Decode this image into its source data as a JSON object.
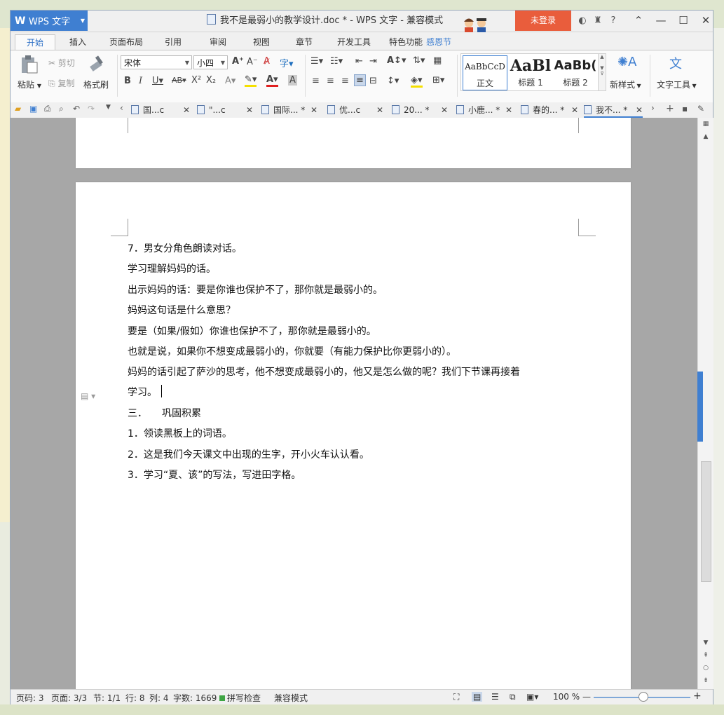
{
  "window": {
    "app_button": "WPS 文字",
    "title": "我不是最弱小的教学设计.doc * - WPS 文字 - 兼容模式",
    "login": "未登录"
  },
  "menu": {
    "tabs": [
      "开始",
      "插入",
      "页面布局",
      "引用",
      "审阅",
      "视图",
      "章节",
      "开发工具",
      "特色功能",
      "感恩节"
    ]
  },
  "ribbon": {
    "paste": "粘贴",
    "cut": "剪切",
    "copy": "复制",
    "format_painter": "格式刷",
    "font_name": "宋体",
    "font_size": "小四",
    "styles": [
      {
        "preview": "AaBbCcD",
        "label": "正文"
      },
      {
        "preview": "AaBl",
        "label": "标题 1"
      },
      {
        "preview": "AaBb(",
        "label": "标题 2"
      }
    ],
    "new_style": "新样式",
    "text_tools": "文字工具"
  },
  "doc_tabs": [
    "国...c",
    "\"...c",
    "国际... *",
    "优...c",
    "20... *",
    "小鹿... *",
    "春的... *",
    "我不... *"
  ],
  "document": {
    "lines": [
      "7．男女分角色朗读对话。",
      "学习理解妈妈的话。",
      "出示妈妈的话：要是你谁也保护不了，那你就是最弱小的。",
      "妈妈这句话是什么意思？",
      "要是（如果/假如）你谁也保护不了，那你就是最弱小的。",
      "也就是说，如果你不想变成最弱小的，你就要（有能力保护比你更弱小的）。",
      "妈妈的话引起了萨沙的思考，他不想变成最弱小的，他又是怎么做的呢？我们下节课再接着",
      "学习。",
      "三．　　巩固积累",
      "1．领读黑板上的词语。",
      "2．这是我们今天课文中出现的生字，开小火车认认看。",
      "3．学习“夏、该”的写法，写进田字格。"
    ]
  },
  "status": {
    "page_code": "页码: 3",
    "pages": "页面: 3/3",
    "section": "节: 1/1",
    "row": "行: 8",
    "col": "列: 4",
    "word_count": "字数: 1669",
    "spell_check": "拼写检查",
    "compat_mode": "兼容模式",
    "zoom": "100 %"
  },
  "colors": {
    "accent": "#3f7fd1",
    "login_bg": "#e95d3c",
    "spell_ok": "#3fa544"
  }
}
